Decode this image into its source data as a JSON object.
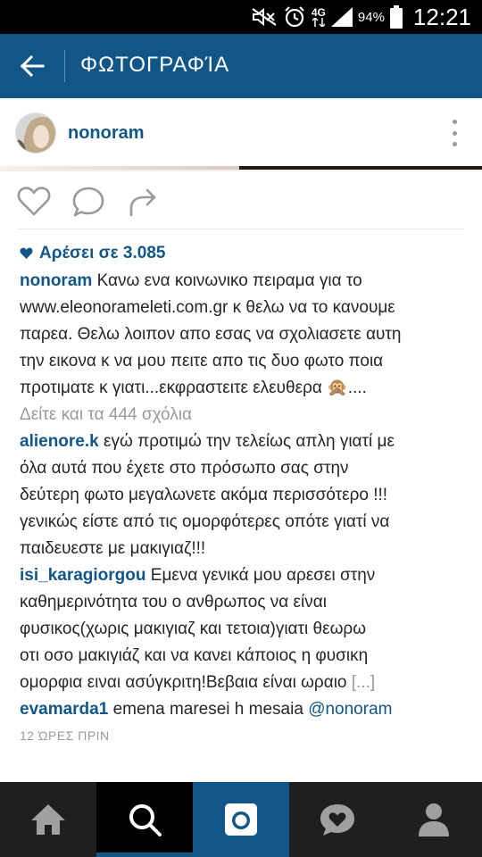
{
  "status_bar": {
    "icons": [
      "mute-icon",
      "alarm-icon",
      "network-4g-icon",
      "signal-icon",
      "battery-icon"
    ],
    "network": "4G",
    "battery": "94%",
    "time": "12:21"
  },
  "app_bar": {
    "title": "ΦΩΤΟΓΡΑΦΊΑ",
    "background": "#125688"
  },
  "post": {
    "username": "nonoram",
    "likes_text": "Αρέσει σε 3.085",
    "caption": {
      "user": "nonoram",
      "lines": [
        "Κανω ενα κοινωνικο πειραμα για το",
        "www.eleonorameleti.com.gr κ θελω να το κανουμε",
        "παρεα. Θελω λοιπον απο εσας να σχολιασετε αυτη",
        "την εικονα κ να μου πειτε απο τις δυο φωτο ποια",
        "προτιματε κ γιατι...εκφραστειτε ελευθερα 🙊...."
      ]
    },
    "view_all_comments": "Δείτε και τα 444 σχόλια",
    "comments": [
      {
        "user": "alienore.k",
        "lines": [
          "εγώ προτιμώ την τελείως απλη γιατί με",
          "όλα αυτά που έχετε στο πρόσωπο σας στην",
          "δεύτερη φωτο μεγαλωνετε ακόμα περισσότερο !!!",
          "γενικώς είστε από τις ομορφότερες οπότε γιατί να",
          "παιδευεστε με μακιγιαζ!!!"
        ]
      },
      {
        "user": "isi_karagiorgou",
        "lines": [
          "Εμενα γενικά μου αρεσει στην",
          "καθημερινότητα του ο ανθρωπος να είναι",
          "φυσικος(χωρις μακιγιαζ και τετοια)γιατι θεωρω",
          "οτι οσο μακιγιάζ και να κανει κάποιος η φυσικη",
          "ομορφια ειναι ασύγκριτη!Βεβαια είναι ωραιο"
        ],
        "more": "[...]"
      },
      {
        "user": "evamarda1",
        "text": "emena maresei h mesaia",
        "mention": "@nonoram"
      }
    ],
    "timestamp": "12 ΏΡΕΣ ΠΡΙΝ"
  },
  "bottom_nav": {
    "items": [
      "home-icon",
      "search-icon",
      "camera-icon",
      "activity-heart-icon",
      "profile-icon"
    ],
    "active": "search-icon"
  }
}
